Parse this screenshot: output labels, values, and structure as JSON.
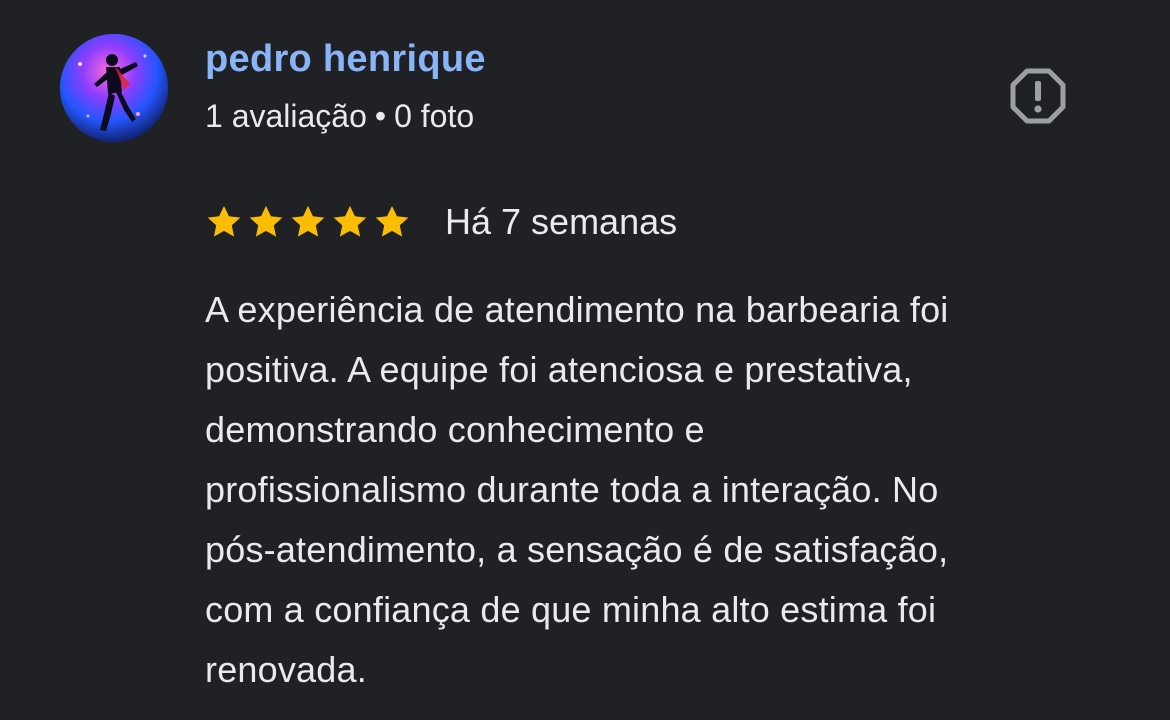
{
  "author": {
    "name": "pedro henrique",
    "reviews_count": "1 avaliação",
    "separator": "•",
    "photos_count": "0 foto"
  },
  "report": {
    "icon": "report-icon"
  },
  "rating": {
    "stars": 5,
    "max_stars": 5,
    "star_color": "#fbbc04",
    "date": "Há 7 semanas"
  },
  "review": {
    "lines": [
      "A experiência de atendimento na barbearia foi",
      "positiva. A equipe foi atenciosa e prestativa,",
      "demonstrando conhecimento e",
      "profissionalismo durante toda a interação. No",
      "pós-atendimento, a sensação é de satisfação,",
      "com a confiança de que minha alto estima foi",
      "renovada."
    ]
  },
  "colors": {
    "background": "#202124",
    "name": "#8ab4f8",
    "text": "#e8eaed",
    "icon": "#9aa0a6"
  }
}
